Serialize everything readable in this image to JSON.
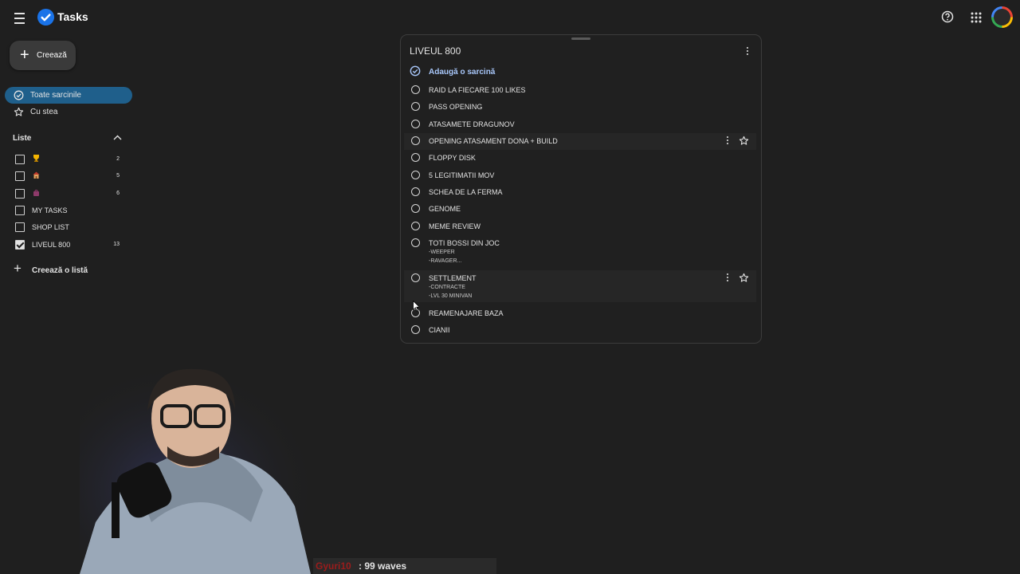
{
  "header": {
    "app_title": "Tasks",
    "icons": [
      "menu-icon",
      "tasks-logo-icon",
      "help-icon",
      "apps-grid-icon",
      "avatar"
    ]
  },
  "sidebar": {
    "create_label": "Creează",
    "nav": [
      {
        "label": "Toate sarcinile",
        "icon": "check-circle-icon",
        "active": true
      },
      {
        "label": "Cu stea",
        "icon": "star-icon",
        "active": false
      }
    ],
    "lists_title": "Liste",
    "lists": [
      {
        "label": "",
        "emoji": "trophy-emoji",
        "count": "2",
        "checked": false
      },
      {
        "label": "",
        "emoji": "house-emoji",
        "count": "5",
        "checked": false
      },
      {
        "label": "",
        "emoji": "purse-emoji",
        "count": "6",
        "checked": false
      },
      {
        "label": "MY TASKS",
        "count": "",
        "checked": false
      },
      {
        "label": "SHOP LIST",
        "count": "",
        "checked": false
      },
      {
        "label": "LIVEUL 800",
        "count": "13",
        "checked": true
      }
    ],
    "create_list_label": "Creează o listă"
  },
  "card": {
    "title": "LIVEUL 800",
    "add_task_label": "Adaugă o sarcină",
    "tasks": [
      {
        "title": "RAID LA FIECARE 100 LIKES",
        "notes": []
      },
      {
        "title": "PASS OPENING",
        "notes": []
      },
      {
        "title": "ATASAMETE DRAGUNOV",
        "notes": []
      },
      {
        "title": "OPENING ATASAMENT DONA + BUILD",
        "notes": [],
        "hover": true
      },
      {
        "title": "FLOPPY DISK",
        "notes": []
      },
      {
        "title": "5 LEGITIMATII MOV",
        "notes": []
      },
      {
        "title": "SCHEA DE LA FERMA",
        "notes": []
      },
      {
        "title": "GENOME",
        "notes": []
      },
      {
        "title": "MEME REVIEW",
        "notes": []
      },
      {
        "title": "TOTI BOSSI DIN JOC",
        "notes": [
          "-WEEPER",
          "-RAVAGER..."
        ]
      },
      {
        "title": "SETTLEMENT",
        "notes": [
          "-CONTRACTE",
          "-LVL 30 MINIVAN"
        ],
        "hover": true
      },
      {
        "title": "REAMENAJARE BAZA",
        "notes": []
      },
      {
        "title": "CIANII",
        "notes": []
      }
    ]
  },
  "overlay": {
    "user": "Gyuri10",
    "message": ": 99 waves"
  },
  "colors": {
    "background": "#1f1f1f",
    "active_nav": "#1f5f8b",
    "accent_link": "#a8c7fa",
    "chat_user": "#9b1c1c"
  }
}
